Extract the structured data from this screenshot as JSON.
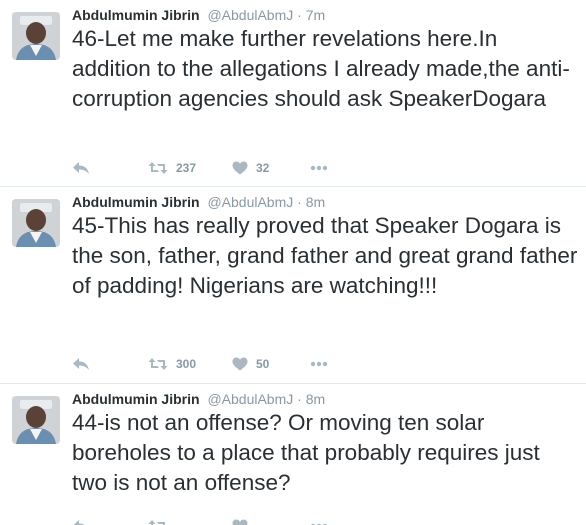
{
  "tweets": [
    {
      "author": "Abdulmumin Jibrin",
      "handle": "@AbdulAbmJ",
      "separator": "·",
      "time": "7m",
      "text": "46-Let me make further revelations here.In addition to the allegations I already made,the anti-corruption agencies should ask SpeakerDogara",
      "retweets": "237",
      "likes": "32"
    },
    {
      "author": "Abdulmumin Jibrin",
      "handle": "@AbdulAbmJ",
      "separator": "·",
      "time": "8m",
      "text": "45-This has really proved that Speaker Dogara is the son, father, grand father and great grand father of padding! Nigerians are watching!!!",
      "retweets": "300",
      "likes": "50"
    },
    {
      "author": "Abdulmumin Jibrin",
      "handle": "@AbdulAbmJ",
      "separator": "·",
      "time": "8m",
      "text": "44-is not an offense? Or moving ten solar boreholes to a place that probably requires just two is not an offense?",
      "retweets": "",
      "likes": ""
    }
  ],
  "icons": {
    "reply": "reply-icon",
    "retweet": "retweet-icon",
    "like": "heart-icon",
    "more": "more-icon"
  },
  "colors": {
    "text": "#292f33",
    "muted": "#8899a6",
    "divider": "#e1e8ed"
  }
}
